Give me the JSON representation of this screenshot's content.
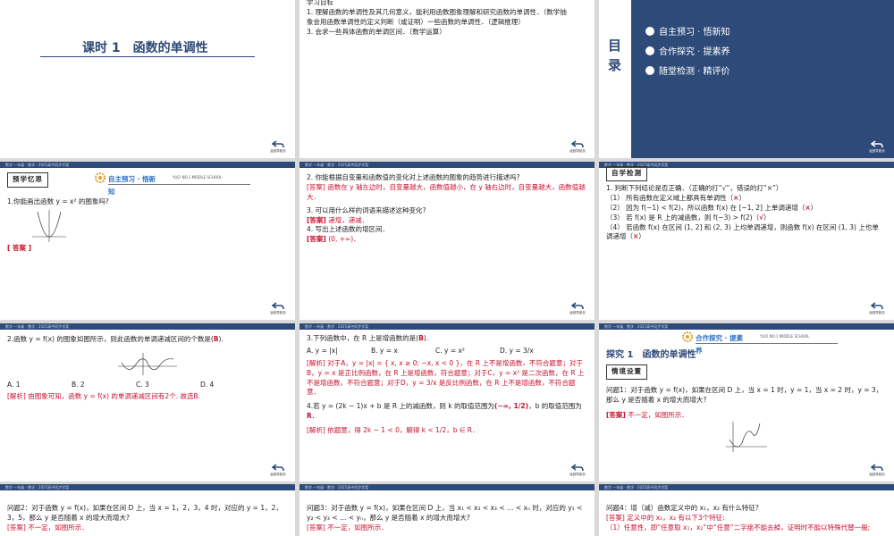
{
  "back_label": "返回导航页",
  "topbar_text": "数学 一年级 · 数学 · 2025高中同步学案",
  "s1": {
    "title": "课时 1　函数的单调性"
  },
  "s2": {
    "heading": "学习目标",
    "goals": [
      "1. 理解函数的单调性及其几何意义，能利用函数图象理解和研究函数的单调性．（数学抽",
      "象会用函数单调性的定义判断（或证明）一些函数的单调性．（逻辑推理）",
      "3. 会求一些具体函数的单调区间．（数学运算）"
    ]
  },
  "s3": {
    "mulu": [
      "目",
      "录"
    ],
    "items": [
      "自主预习 · 悟新知",
      "合作探究 · 提素养",
      "随堂检测 · 精评价"
    ],
    "accent": "#1f5fa8"
  },
  "s4": {
    "section": "自主预习 · 悟新",
    "section_tail": "知",
    "school": "YUCI NO.1 MIDDLE SCHOOL",
    "label": "预学忆思",
    "q1": "1.你能画出函数 y = x² 的图象吗?",
    "answer": "[ 答案 ]"
  },
  "s5": {
    "q2": "2. 你能根据自变量和函数值的变化对上述函数的图象的趋势进行描述吗?",
    "a2": "[答案] 函数在 y 轴左边时，自变量越大，函数值越小，在 y 轴右边时，自变量越大，函数值越大．",
    "q3": "3. 可以用什么样的词语来描述这种变化?",
    "a3_tag": "[答案]",
    "a3": " 递增，递减．",
    "q4": "4. 写出上述函数的增区间．",
    "a4_tag": "[答案]",
    "a4": " (0, +∞)．"
  },
  "s6": {
    "label": "自学检测",
    "q": "1. 判断下列结论是否正确．（正确的打“√”，错误的打“×”）",
    "items": [
      {
        "text": "（1）  所有函数在定义域上都具有单调性（",
        "mark": "×",
        "tail": "）"
      },
      {
        "text": "（2）  因为 f(−1) < f(2)，所以函数 f(x) 在 [−1, 2] 上单调递增（",
        "mark": "×",
        "tail": "）"
      },
      {
        "text": "（3）  若 f(x) 是 R 上的减函数，则 f(−3) > f(2)（",
        "mark": "√",
        "tail": "）"
      },
      {
        "text": "（4）  若函数 f(x) 在区间 (1, 2] 和 (2, 3) 上均单调递增，则函数 f(x) 在区间 (1, 3) 上也单调递增（",
        "mark": "×",
        "tail": "）"
      }
    ]
  },
  "s7": {
    "q_pre": "2.函数 y = f(x) 的图象如图所示，则此函数的单调递减区间的个数是(",
    "q_ans": "B",
    "q_post": ").",
    "options": [
      "A. 1",
      "B. 2",
      "C. 3",
      "D. 4"
    ],
    "analysis": "[解析] 由图象可知，函数 y = f(x) 的单调递减区间有2个. 故选B."
  },
  "s8": {
    "q3_pre": "3.下列函数中，在 R 上是增函数的是(",
    "q3_ans": "B",
    "q3_post": ").",
    "options": [
      "A. y = |x|",
      "B. y = x",
      "C. y = x²",
      "D. y = 3/x"
    ],
    "analysis": "[解析] 对于A，y = |x| = { x, x ≥ 0; −x, x < 0 }，在 R 上不是增函数，不符合题意；对于B，y = x 是正比例函数，在 R 上是增函数，符合题意；对于C，y = x² 是二次函数，在 R 上不是增函数，不符合题意；对于D，y = 3/x 是反比例函数，在 R 上不是增函数，不符合题意．",
    "q4_pre": "4.若 y = (2k − 1)x + b 是 R 上的减函数，则 k 的取值范围为",
    "q4_ans1": "(−∞, 1/2)",
    "q4_mid": "，b 的取值范围为",
    "q4_ans2": "R",
    "q4_post": "．",
    "analysis2": "[解析] 依题意，得 2k − 1 < 0，解得 k < 1/2，b ∈ R．"
  },
  "s9": {
    "section": "合作探究 · 提素",
    "section_tail": "养",
    "school": "YUCI NO.1 MIDDLE SCHOOL",
    "explore": "探究 1　函数的单调性",
    "label": "情境设置",
    "q": "问题1：对于函数 y = f(x)，如果在区间 D 上，当 x = 1 时，y = 1，当 x = 2 时，y = 3，那么 y 是否随着 x 的增大而增大?",
    "ans_tag": "[答案]",
    "ans": " 不一定，如图所示．"
  },
  "s10": {
    "q": "问题2：对于函数 y = f(x)，如果在区间 D 上，当 x = 1，2，3，4 时，对应的 y = 1，2，3，5，那么 y 是否随着 x 的增大而增大?",
    "ans": "[答案] 不一定，如图所示．"
  },
  "s11": {
    "q": "问题3：对于函数 y = f(x)，如果在区间 D 上，当 x₁ < x₂ < x₃ < … < xₙ 时，对应的 y₁ < y₂ < y₃ < … < yₙ，那么 y 是否随着 x 的增大而增大?",
    "ans": "[答案] 不一定，如图所示．"
  },
  "s12": {
    "q": "问题4：增（减）函数定义中的 x₁，x₂ 有什么特征?",
    "ans": "[答案] 定义中的 x₁，x₂ 有以下3个特征:",
    "ans2": "（1）任意性，即“任意取 x₁，x₂”中“任意”二字绝不能去掉，证明时不能以特殊代替一般;"
  }
}
